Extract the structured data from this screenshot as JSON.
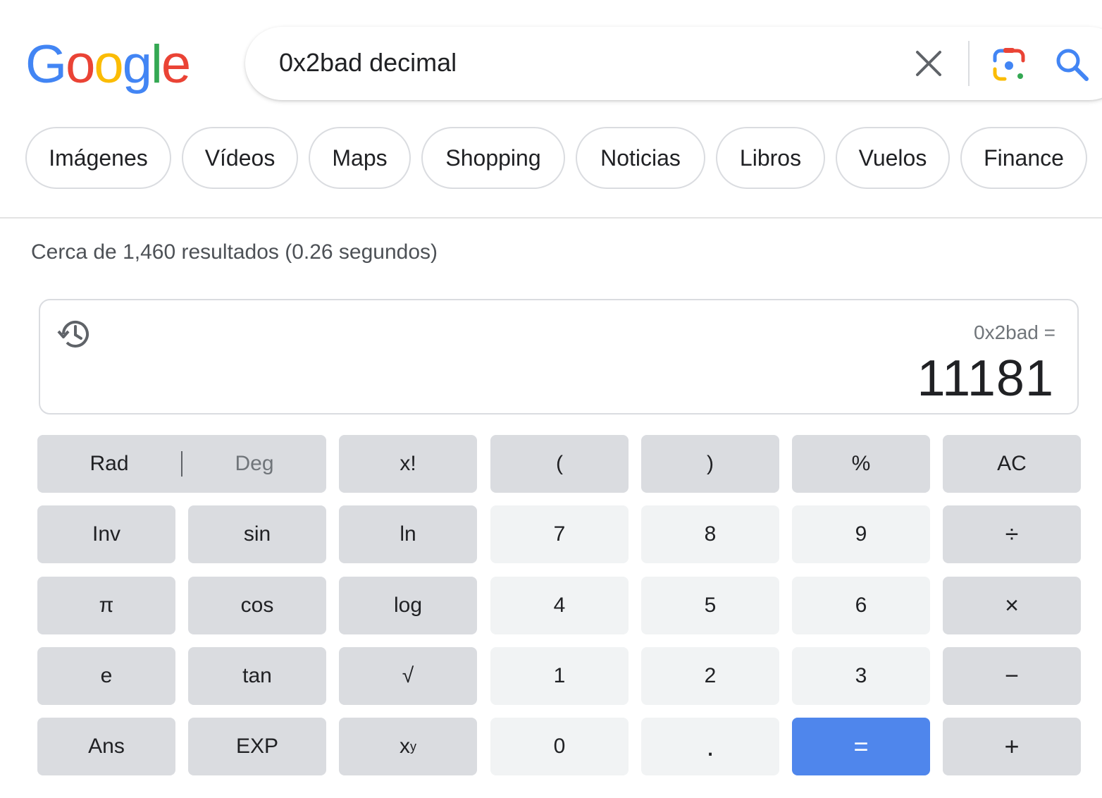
{
  "logo": {
    "text": "Google",
    "letters": [
      {
        "ch": "G",
        "color": "#4285F4"
      },
      {
        "ch": "o",
        "color": "#EA4335"
      },
      {
        "ch": "o",
        "color": "#FBBC05"
      },
      {
        "ch": "g",
        "color": "#4285F4"
      },
      {
        "ch": "l",
        "color": "#34A853"
      },
      {
        "ch": "e",
        "color": "#EA4335"
      }
    ]
  },
  "search": {
    "query": "0x2bad decimal",
    "icons": {
      "clear": "close-icon",
      "lens": "google-lens-icon",
      "submit": "search-icon"
    }
  },
  "chips": [
    "Imágenes",
    "Vídeos",
    "Maps",
    "Shopping",
    "Noticias",
    "Libros",
    "Vuelos",
    "Finance"
  ],
  "results_stats": "Cerca de 1,460 resultados (0.26 segundos)",
  "calculator": {
    "history_icon": "history-icon",
    "expression": "0x2bad =",
    "result": "11181",
    "keys": {
      "rad": "Rad",
      "deg": "Deg",
      "fact": "x!",
      "lparen": "(",
      "rparen": ")",
      "percent": "%",
      "ac": "AC",
      "inv": "Inv",
      "sin": "sin",
      "ln": "ln",
      "n7": "7",
      "n8": "8",
      "n9": "9",
      "div": "÷",
      "pi": "π",
      "cos": "cos",
      "log": "log",
      "n4": "4",
      "n5": "5",
      "n6": "6",
      "mul": "×",
      "e": "e",
      "tan": "tan",
      "sqrt": "√",
      "n1": "1",
      "n2": "2",
      "n3": "3",
      "sub": "−",
      "ans": "Ans",
      "exp": "EXP",
      "pow_base": "x",
      "pow_exp": "y",
      "n0": "0",
      "dot": ".",
      "eq": "=",
      "add": "+"
    }
  },
  "colors": {
    "equals_key": "#4f86ec",
    "fn_key": "#dadce0",
    "num_key": "#f1f3f4"
  }
}
